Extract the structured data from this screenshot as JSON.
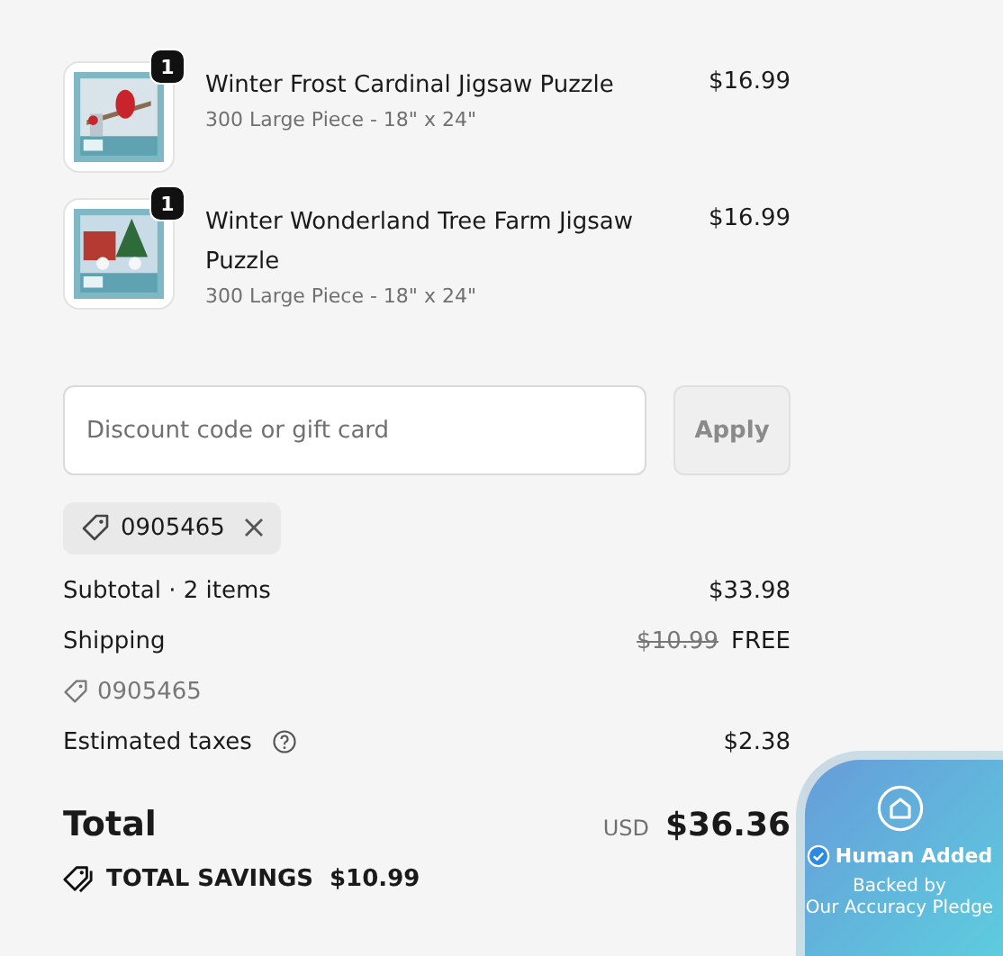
{
  "items": [
    {
      "quantity": "1",
      "name": "Winter Frost Cardinal Jigsaw Puzzle",
      "variant": "300 Large Piece - 18\" x 24\"",
      "price": "$16.99"
    },
    {
      "quantity": "1",
      "name": "Winter Wonderland Tree Farm Jigsaw Puzzle",
      "variant": "300 Large Piece - 18\" x 24\"",
      "price": "$16.99"
    }
  ],
  "discount": {
    "placeholder": "Discount code or gift card",
    "button": "Apply",
    "button_disabled": true,
    "applied_code": "0905465"
  },
  "summary": {
    "subtotal_label": "Subtotal · 2 items",
    "subtotal": "$33.98",
    "shipping_label": "Shipping",
    "shipping_original": "$10.99",
    "shipping": "FREE",
    "shipping_code": "0905465",
    "taxes_label": "Estimated taxes",
    "taxes": "$2.38",
    "total_label": "Total",
    "currency": "USD",
    "total": "$36.36",
    "savings_label": "TOTAL SAVINGS",
    "savings": "$10.99"
  },
  "badge": {
    "title": "Human Added",
    "subtitle_line1": "Backed by",
    "subtitle_line2": "Our Accuracy Pledge"
  }
}
